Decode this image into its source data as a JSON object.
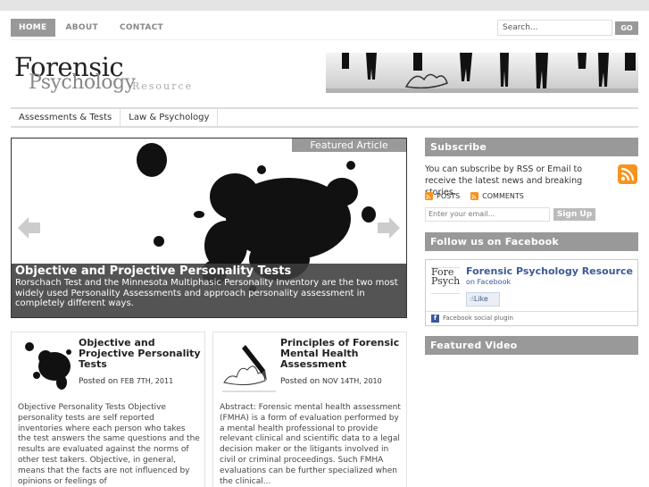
{
  "nav": {
    "items": [
      "HOME",
      "ABOUT",
      "CONTACT"
    ]
  },
  "search": {
    "placeholder": "Search...",
    "button": "GO"
  },
  "logo": {
    "line1": "Forensic",
    "line2": "Psychology",
    "line3": "Resource"
  },
  "categories": [
    "Assessments & Tests",
    "Law & Psychology"
  ],
  "featured": {
    "label": "Featured Article",
    "title": "Objective and Projective Personality Tests",
    "description": "Rorschach Test and the Minnesota Multiphasic Personality Inventory are the two most widely used Personality Assessments and approach personality assessment in completely different ways."
  },
  "posts": [
    {
      "title": "Objective and Projective Personality Tests",
      "posted_on": "Posted on",
      "date": "FEB 7TH, 2011",
      "excerpt": "Objective Personality Tests Objective personality tests are self reported inventories where each person who takes the test answers the same questions and the results are evaluated against the norms of other test takers. Objective, in general, means that the facts are not influenced by opinions or feelings of"
    },
    {
      "title": "Principles of Forensic Mental Health Assessment",
      "posted_on": "Posted on",
      "date": "NOV 14TH, 2010",
      "excerpt": "Abstract: Forensic mental health assessment (FMHA) is a form of evaluation performed by a mental health professional to provide relevant clinical and scientific data to a legal decision maker or the litigants involved in civil or criminal proceedings. Such FMHA evaluations can be further specialized when the clinical..."
    }
  ],
  "sidebar": {
    "subscribe": {
      "heading": "Subscribe",
      "text": "You can subscribe by RSS or Email to receive the latest news and breaking stories.",
      "posts_link": "POSTS",
      "comments_link": "COMMENTS",
      "email_placeholder": "Enter your email...",
      "signup": "Sign Up"
    },
    "facebook": {
      "heading": "Follow us on Facebook",
      "page_name": "Forensic Psychology Resource",
      "on_facebook": "on Facebook",
      "like": "Like",
      "plugin_label": "Facebook social plugin",
      "thumb_text": "Fore Psych"
    },
    "video": {
      "heading": "Featured Video"
    }
  },
  "colors": {
    "accent_gray": "#999999",
    "facebook_blue": "#3b5998",
    "rss_orange": "#f7931e"
  }
}
